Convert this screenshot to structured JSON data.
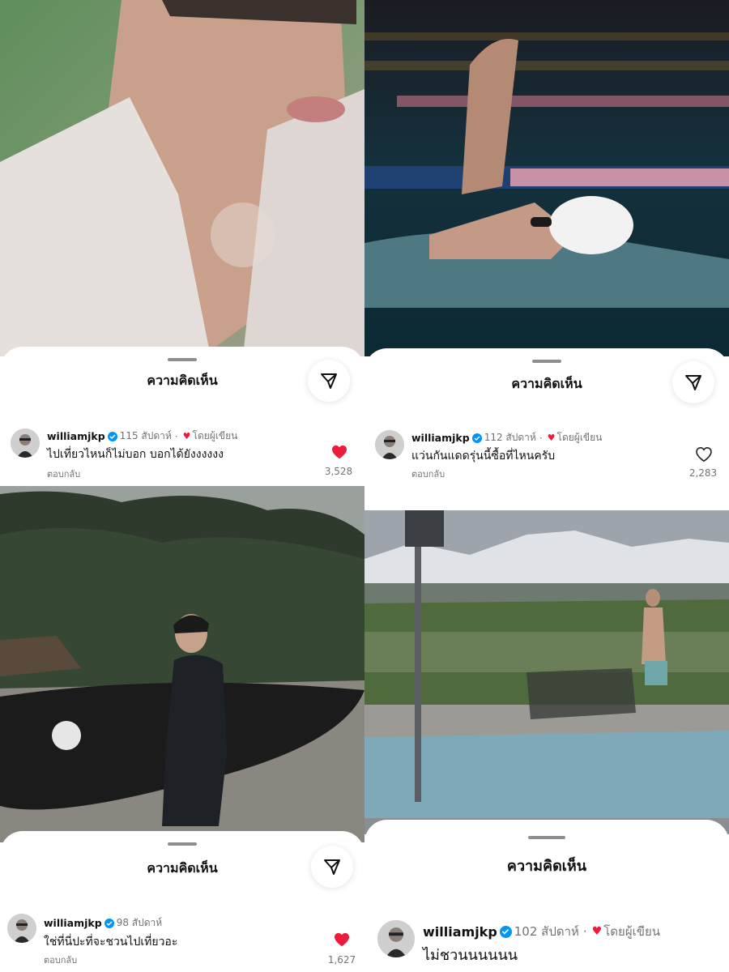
{
  "panels": [
    {
      "sheet_title": "ความคิดเห็น",
      "username": "williamjkp",
      "time": "115 สัปดาห์",
      "separator": "·",
      "liked_by_author": "โดยผู้เขียน",
      "comment": "ไปเที่ยวไหนก็ไม่บอก บอกได้ยังงงงงง",
      "reply": "ตอบกลับ",
      "like_count": "3,528",
      "liked": true
    },
    {
      "sheet_title": "ความคิดเห็น",
      "username": "williamjkp",
      "time": "112 สัปดาห์",
      "separator": "·",
      "liked_by_author": "โดยผู้เขียน",
      "comment": "แว่นกันแดดรุ่นนี้ซื้อที่ไหนครับ",
      "reply": "ตอบกลับ",
      "like_count": "2,283",
      "liked": false
    },
    {
      "sheet_title": "ความคิดเห็น",
      "username": "williamjkp",
      "time": "98 สัปดาห์",
      "comment": "ใช่ที่นี่ปะที่จะชวนไปเที่ยวอะ",
      "reply": "ตอบกลับ",
      "like_count": "1,627",
      "liked": true
    },
    {
      "sheet_title": "ความคิดเห็น",
      "username": "williamjkp",
      "time": "102 สัปดาห์",
      "separator": "·",
      "liked_by_author": "โดยผู้เขียน",
      "comment": "ไม่ชวนนนนนน"
    }
  ],
  "icons": {
    "share": "paper-plane-icon",
    "heart_filled": "heart-filled-icon",
    "heart_outline": "heart-outline-icon",
    "verified": "verified-badge-icon"
  },
  "colors": {
    "like_red": "#ed1c3a",
    "verified_blue": "#0095f6",
    "muted_text": "#737373"
  }
}
